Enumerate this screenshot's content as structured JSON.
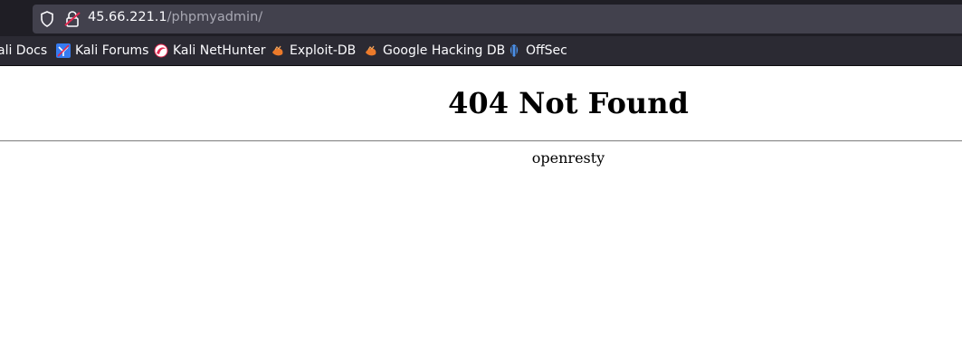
{
  "browser": {
    "url_host": "45.66.221.1",
    "url_path": "/phpmyadmin/",
    "bookmarks": [
      {
        "label": "ali Docs",
        "icon": "kali-docs-icon"
      },
      {
        "label": "Kali Forums",
        "icon": "kali-forums-icon"
      },
      {
        "label": "Kali NetHunter",
        "icon": "kali-nethunter-icon"
      },
      {
        "label": "Exploit-DB",
        "icon": "exploit-db-icon"
      },
      {
        "label": "Google Hacking DB",
        "icon": "exploit-db-icon"
      },
      {
        "label": "OffSec",
        "icon": "offsec-icon"
      }
    ]
  },
  "page": {
    "heading": "404 Not Found",
    "server": "openresty"
  }
}
